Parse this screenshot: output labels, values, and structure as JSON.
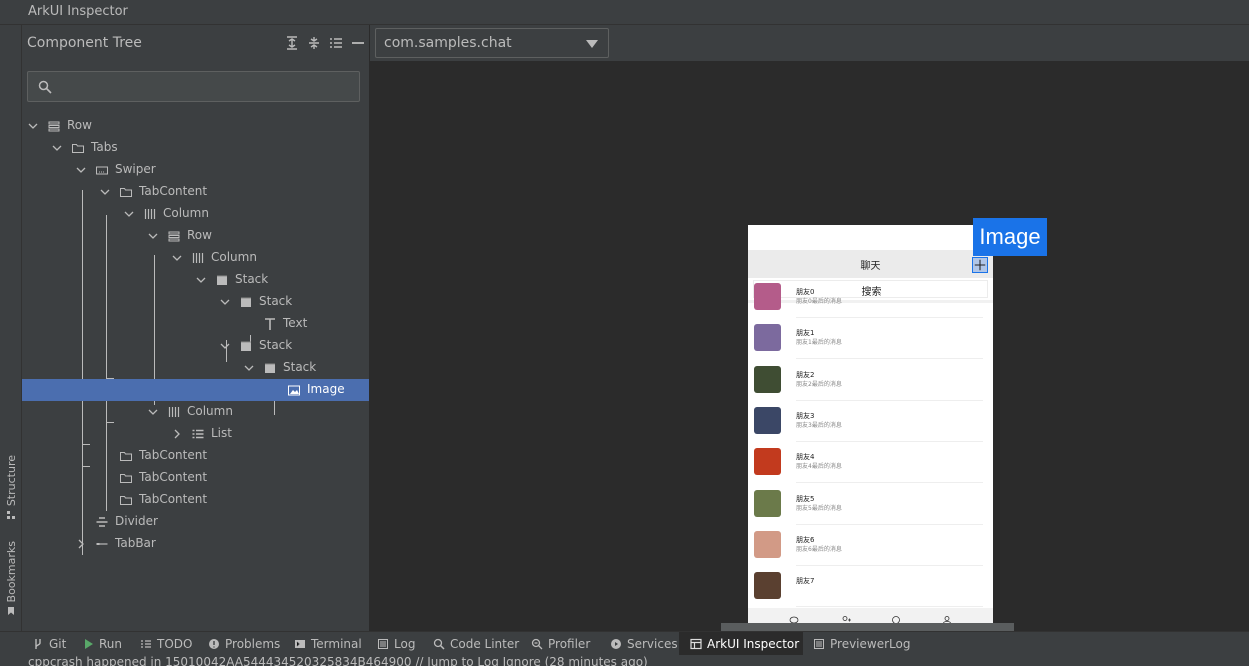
{
  "window": {
    "title": "ArkUI Inspector"
  },
  "side_tabs": {
    "structure": "Structure",
    "bookmarks": "Bookmarks"
  },
  "tree_panel": {
    "title": "Component Tree",
    "search_placeholder": "",
    "nodes": [
      {
        "label": "Row",
        "icon": "row-icon",
        "expanded": true
      },
      {
        "label": "Tabs",
        "icon": "folder-icon",
        "expanded": true
      },
      {
        "label": "Swiper",
        "icon": "swiper-icon",
        "expanded": true
      },
      {
        "label": "TabContent",
        "icon": "folder-icon",
        "expanded": true
      },
      {
        "label": "Column",
        "icon": "column-icon",
        "expanded": true
      },
      {
        "label": "Row",
        "icon": "row-icon",
        "expanded": true
      },
      {
        "label": "Column",
        "icon": "column-icon",
        "expanded": true
      },
      {
        "label": "Stack",
        "icon": "stack-icon",
        "expanded": true
      },
      {
        "label": "Stack",
        "icon": "stack-icon",
        "expanded": true
      },
      {
        "label": "Text",
        "icon": "text-icon",
        "expanded": false
      },
      {
        "label": "Stack",
        "icon": "stack-icon",
        "expanded": true
      },
      {
        "label": "Stack",
        "icon": "stack-icon",
        "expanded": true
      },
      {
        "label": "Image",
        "icon": "image-icon",
        "expanded": false,
        "selected": true
      },
      {
        "label": "Column",
        "icon": "column-icon",
        "expanded": true
      },
      {
        "label": "List",
        "icon": "list-icon",
        "expanded": false
      },
      {
        "label": "TabContent",
        "icon": "folder-icon",
        "expanded": false
      },
      {
        "label": "TabContent",
        "icon": "folder-icon",
        "expanded": false
      },
      {
        "label": "TabContent",
        "icon": "folder-icon",
        "expanded": false
      },
      {
        "label": "Divider",
        "icon": "divider-icon",
        "expanded": false
      },
      {
        "label": "TabBar",
        "icon": "tabbar-icon",
        "expanded": false
      }
    ]
  },
  "toolbar": {
    "app_selector": "com.samples.chat"
  },
  "preview": {
    "header_title": "聊天",
    "search_label": "搜索",
    "selected_label": "Image",
    "chats": [
      {
        "name": "朋友0",
        "message": "朋友0最后的消息",
        "color": "#b45c8a"
      },
      {
        "name": "朋友1",
        "message": "朋友1最后的消息",
        "color": "#7c6a9e"
      },
      {
        "name": "朋友2",
        "message": "朋友2最后的消息",
        "color": "#3f4d33"
      },
      {
        "name": "朋友3",
        "message": "朋友3最后的消息",
        "color": "#3b4766"
      },
      {
        "name": "朋友4",
        "message": "朋友4最后的消息",
        "color": "#c23a1e"
      },
      {
        "name": "朋友5",
        "message": "朋友5最后的消息",
        "color": "#6b7a4a"
      },
      {
        "name": "朋友6",
        "message": "朋友6最后的消息",
        "color": "#d29a86"
      },
      {
        "name": "朋友7",
        "message": "",
        "color": "#5a4030"
      }
    ]
  },
  "bottom_tabs": [
    {
      "label": "Git",
      "icon": "git-icon"
    },
    {
      "label": "Run",
      "icon": "run-icon"
    },
    {
      "label": "TODO",
      "icon": "todo-icon"
    },
    {
      "label": "Problems",
      "icon": "problems-icon"
    },
    {
      "label": "Terminal",
      "icon": "terminal-icon"
    },
    {
      "label": "Log",
      "icon": "log-icon"
    },
    {
      "label": "Code Linter",
      "icon": "linter-icon"
    },
    {
      "label": "Profiler",
      "icon": "profiler-icon"
    },
    {
      "label": "Services",
      "icon": "services-icon"
    },
    {
      "label": "ArkUI Inspector",
      "icon": "inspector-icon",
      "active": true
    },
    {
      "label": "PreviewerLog",
      "icon": "previewer-log-icon"
    }
  ],
  "status": {
    "message": "cppcrash happened in 15010042AA544434520325834B464900 // Jump to Log   Ignore (28 minutes ago)"
  },
  "colors": {
    "accent": "#4b6eaf",
    "highlight": "#1a73e8",
    "panel": "#3c3f41",
    "background": "#2b2b2b"
  }
}
